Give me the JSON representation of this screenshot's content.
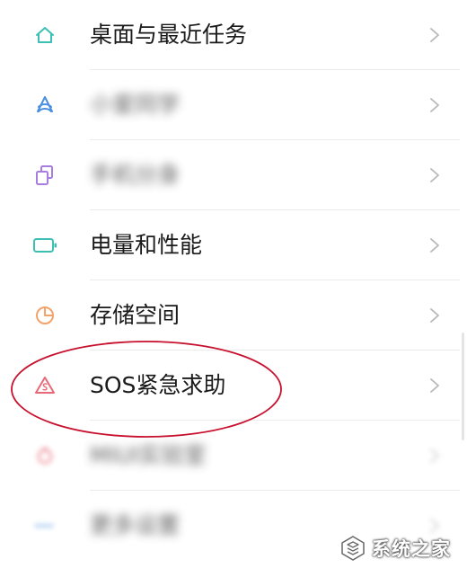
{
  "settings_list": {
    "items": [
      {
        "label": "桌面与最近任务",
        "icon": "home-icon",
        "blurred": false
      },
      {
        "label": "小爱同学",
        "icon": "xiaoai-icon",
        "blurred": true
      },
      {
        "label": "手机分身",
        "icon": "clone-icon",
        "blurred": true
      },
      {
        "label": "电量和性能",
        "icon": "battery-icon",
        "blurred": false
      },
      {
        "label": "存储空间",
        "icon": "storage-pie-icon",
        "blurred": false
      },
      {
        "label": "SOS紧急求助",
        "icon": "sos-icon",
        "blurred": false
      },
      {
        "label": "MIUI实验室",
        "icon": "lab-icon",
        "blurred": true
      },
      {
        "label": "更多设置",
        "icon": "more-icon",
        "blurred": true
      }
    ]
  },
  "watermark": {
    "text": "系统之家"
  },
  "colors": {
    "teal_icon": "#3cc0b4",
    "blue_icon": "#4a8fe0",
    "purple_icon": "#a77ee0",
    "orange_icon": "#f2a36a",
    "sos_icon": "#e86a78",
    "highlight_ring": "#c8102e",
    "chevron": "#b8b8b8"
  }
}
